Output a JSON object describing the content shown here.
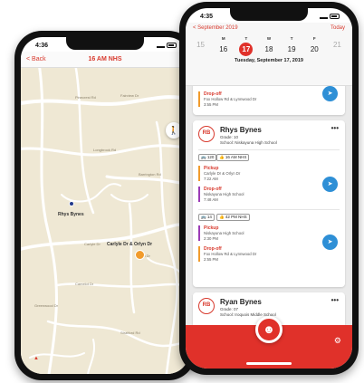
{
  "left_phone": {
    "status_time": "4:36",
    "nav": {
      "back_label": "< Back",
      "title": "16 AM NHS"
    },
    "map": {
      "markers": [
        {
          "label": "Rhys Bynes"
        },
        {
          "label": "Carlyle Dr & Orlyn Dr"
        }
      ],
      "streets": [
        "Pinecrest Rd",
        "Fairview Dr",
        "Longbrook Rd",
        "Barrington Rd",
        "Carlyle Dr",
        "Orlyn Dr",
        "Camelot Dr",
        "Stratford Rd",
        "Greenwood Dr"
      ]
    }
  },
  "right_phone": {
    "status_time": "4:35",
    "calendar": {
      "month_link": "< September 2019",
      "today_link": "Today",
      "days": [
        {
          "wd": "",
          "num": "15",
          "muted": true
        },
        {
          "wd": "M",
          "num": "16",
          "muted": false
        },
        {
          "wd": "T",
          "num": "17",
          "selected": true
        },
        {
          "wd": "W",
          "num": "18",
          "muted": false
        },
        {
          "wd": "T",
          "num": "19",
          "muted": false
        },
        {
          "wd": "F",
          "num": "20",
          "muted": false
        },
        {
          "wd": "",
          "num": "21",
          "muted": true
        }
      ],
      "date_heading": "Tuesday, September 17, 2019"
    },
    "feed": {
      "partial_card": {
        "title": "Drop-off",
        "lines": [
          "Fox Hollow Rd & Lynnwood Dr",
          "3:55 PM"
        ]
      },
      "students": [
        {
          "initials": "RB",
          "name": "Rhys Bynes",
          "grade": "Grade: 10",
          "school": "School: Niskayuna High School",
          "runs": [
            {
              "bus": "120",
              "route": "16 AM NHS",
              "stops": [
                {
                  "title": "Pickup",
                  "lines": [
                    "Carlyle Dr & Orlyn Dr",
                    "7:22 AM"
                  ],
                  "color": "orange"
                },
                {
                  "title": "Drop-off",
                  "lines": [
                    "Niskayuna High School",
                    "7:48 AM"
                  ],
                  "color": "purple"
                }
              ]
            },
            {
              "bus": "14",
              "route": "42 PM NHS",
              "stops": [
                {
                  "title": "Pickup",
                  "lines": [
                    "Niskayuna High School",
                    "2:30 PM"
                  ],
                  "color": "purple"
                },
                {
                  "title": "Drop-off",
                  "lines": [
                    "Fox Hollow Rd & Lynnwood Dr",
                    "2:55 PM"
                  ],
                  "color": "orange"
                }
              ]
            }
          ]
        },
        {
          "initials": "RB",
          "name": "Ryan Bynes",
          "grade": "Grade: 07",
          "school": "School: Iroquois Middle School"
        }
      ]
    }
  }
}
